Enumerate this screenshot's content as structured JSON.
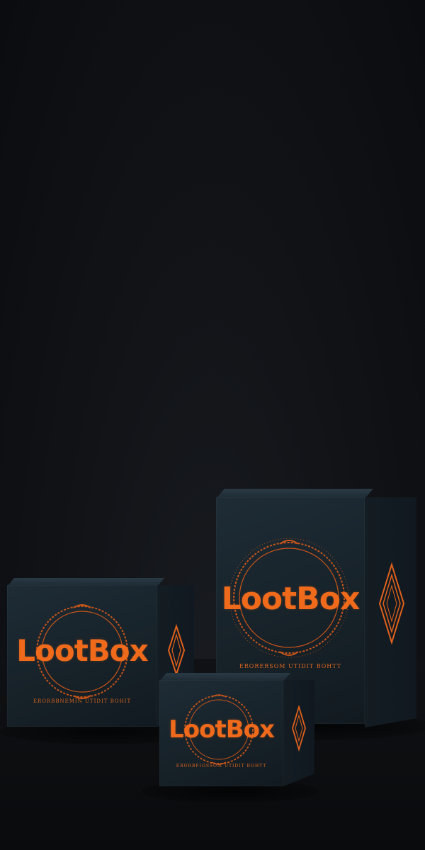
{
  "scene": {
    "background_color": "#121418",
    "accent_color": "#f06a1c",
    "box_color": "#1b2830"
  },
  "boxes": [
    {
      "name": "large",
      "logo": "LootBox",
      "tagline": "ERORERSOM UTIDIT BOHTT"
    },
    {
      "name": "medium",
      "logo": "LootBox",
      "tagline": "ERORBBNEMIN UTIDIT BOHIT"
    },
    {
      "name": "small",
      "logo": "LootBox",
      "tagline": "ERORBFIOSSOM UTIDIT BOHTT"
    }
  ]
}
